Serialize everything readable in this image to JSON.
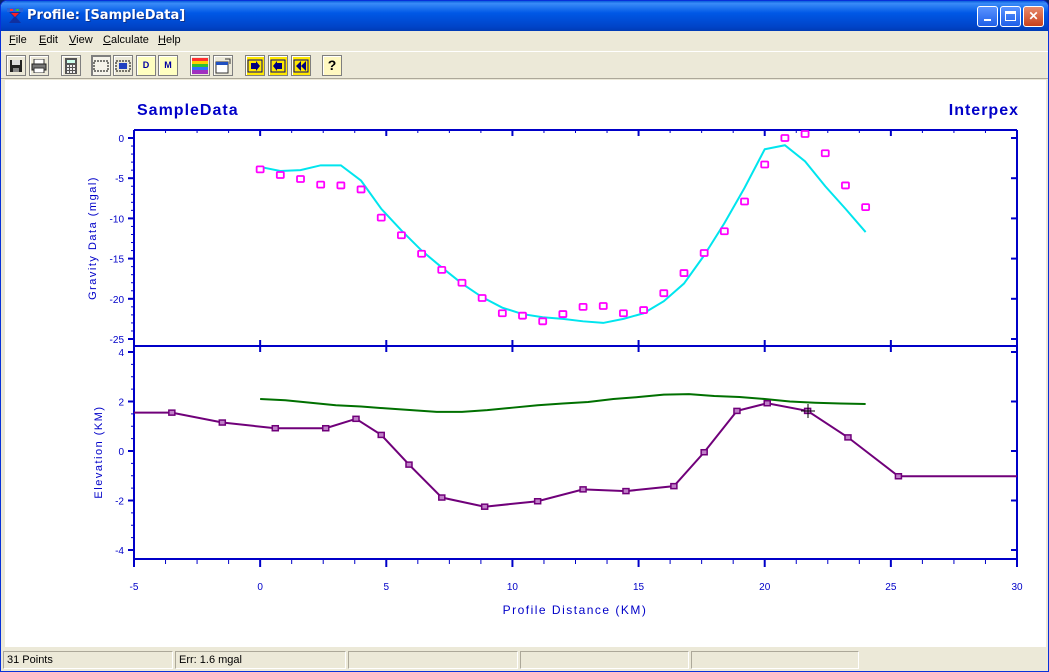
{
  "window": {
    "title": "Profile: [SampleData]",
    "buttons": {
      "minimize": "minimize-icon",
      "maximize": "maximize-icon",
      "close": "close-icon"
    }
  },
  "menu": [
    {
      "label": "File"
    },
    {
      "label": "Edit"
    },
    {
      "label": "View"
    },
    {
      "label": "Calculate"
    },
    {
      "label": "Help"
    }
  ],
  "toolbar": {
    "icons": [
      "save-icon",
      "print-icon",
      "calculator-icon",
      "select-rect-icon",
      "zoom-icon",
      "d-icon",
      "m-icon",
      "color-bars-icon",
      "properties-icon",
      "forward-icon",
      "back-icon",
      "rewind-icon",
      "help-icon"
    ],
    "d_label": "D",
    "m_label": "M",
    "help_label": "?"
  },
  "plot": {
    "left_title": "SampleData",
    "right_title": "Interpex",
    "xlabel": "Profile Distance (KM)",
    "colors": {
      "axis": "#0000c8",
      "observed": "#ff00ff",
      "calculated": "#00e5ee",
      "surface": "#007000",
      "layer": "#70007a"
    }
  },
  "chart_data": [
    {
      "type": "scatter",
      "ylabel": "Gravity Data (mgal)",
      "xlim": [
        -5,
        30
      ],
      "ylim": [
        -25,
        0
      ],
      "xticks": [
        -5,
        0,
        5,
        10,
        15,
        20,
        25,
        30
      ],
      "yticks": [
        0,
        -5,
        -10,
        -15,
        -20,
        -25
      ],
      "ytick_labels": [
        "0",
        "-5",
        "-10",
        "-15",
        "-20",
        "-25"
      ],
      "series": [
        {
          "kind": "observed_points",
          "x": [
            0,
            0.8,
            1.6,
            2.4,
            3.2,
            4.0,
            4.8,
            5.6,
            6.4,
            7.2,
            8.0,
            8.8,
            9.6,
            10.4,
            11.2,
            12.0,
            12.8,
            13.6,
            14.4,
            15.2,
            16.0,
            16.8,
            17.6,
            18.4,
            19.2,
            20.0,
            20.8,
            21.6,
            22.4,
            23.2,
            24.0
          ],
          "y": [
            -3.9,
            -4.6,
            -5.1,
            -5.8,
            -5.9,
            -6.4,
            -9.9,
            -12.1,
            -14.4,
            -16.4,
            -18.0,
            -19.9,
            -21.8,
            -22.1,
            -22.8,
            -21.9,
            -21.0,
            -20.9,
            -21.8,
            -21.4,
            -19.3,
            -16.8,
            -14.3,
            -11.6,
            -7.9,
            -3.3,
            0.0,
            0.5,
            -1.9,
            -5.9,
            -8.6
          ]
        },
        {
          "kind": "calculated_line",
          "x": [
            0,
            0.8,
            1.6,
            2.4,
            3.2,
            4.0,
            4.8,
            5.6,
            6.4,
            7.2,
            8.0,
            8.8,
            9.6,
            10.4,
            11.2,
            12.0,
            12.8,
            13.6,
            14.4,
            15.2,
            16.0,
            16.8,
            17.6,
            18.4,
            19.2,
            20.0,
            20.8,
            21.6,
            22.4,
            23.2,
            24.0
          ],
          "y": [
            -3.6,
            -4.1,
            -4.0,
            -3.4,
            -3.4,
            -5.3,
            -8.8,
            -11.5,
            -14.0,
            -16.1,
            -18.1,
            -19.8,
            -21.1,
            -21.9,
            -22.3,
            -22.5,
            -22.8,
            -23.0,
            -22.5,
            -21.8,
            -20.3,
            -18.1,
            -14.6,
            -10.6,
            -6.2,
            -1.4,
            -0.9,
            -2.9,
            -6.0,
            -8.8,
            -11.7
          ]
        }
      ]
    },
    {
      "type": "line",
      "ylabel": "Elevation (KM)",
      "xlim": [
        -5,
        30
      ],
      "ylim": [
        -4,
        4
      ],
      "xticks": [
        -5,
        0,
        5,
        10,
        15,
        20,
        25,
        30
      ],
      "xtick_labels": [
        "-5",
        "0",
        "5",
        "10",
        "15",
        "20",
        "25",
        "30"
      ],
      "yticks": [
        4,
        2,
        0,
        -2,
        -4
      ],
      "ytick_labels": [
        "4",
        "2",
        "0",
        "-2",
        "-4"
      ],
      "series": [
        {
          "kind": "surface_line",
          "x": [
            0,
            1,
            2,
            3,
            4,
            5,
            6,
            7,
            8,
            9,
            10,
            11,
            12,
            13,
            14,
            15,
            16,
            17,
            18,
            19,
            20,
            21,
            22,
            23,
            24
          ],
          "y": [
            2.1,
            2.05,
            1.95,
            1.85,
            1.8,
            1.72,
            1.65,
            1.58,
            1.58,
            1.65,
            1.75,
            1.85,
            1.92,
            1.98,
            2.1,
            2.18,
            2.28,
            2.3,
            2.22,
            2.18,
            2.1,
            2.0,
            1.95,
            1.92,
            1.9
          ]
        },
        {
          "kind": "layer_boundary",
          "x": [
            -5,
            -3.5,
            -1.5,
            0.6,
            2.6,
            3.8,
            4.8,
            5.9,
            7.2,
            8.9,
            11.0,
            12.8,
            14.5,
            16.4,
            17.6,
            18.9,
            20.1,
            21.7,
            23.3,
            25.3,
            30
          ],
          "y": [
            1.55,
            1.55,
            1.15,
            0.92,
            0.92,
            1.3,
            0.65,
            -0.55,
            -1.88,
            -2.25,
            -2.03,
            -1.55,
            -1.62,
            -1.42,
            -0.05,
            1.62,
            1.93,
            1.62,
            0.55,
            -1.02,
            -1.02
          ]
        }
      ]
    }
  ],
  "status": {
    "points": "31 Points",
    "error": "Err: 1.6 mgal"
  }
}
